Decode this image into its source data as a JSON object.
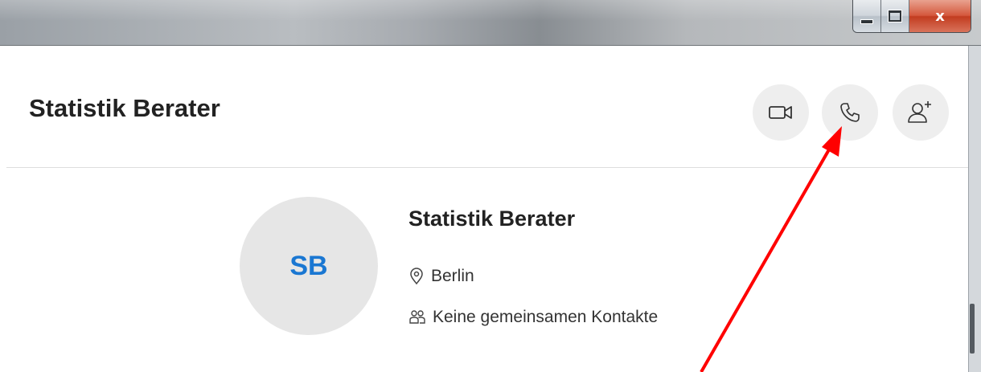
{
  "window": {
    "controls": {
      "minimize": "minimize",
      "maximize": "maximize",
      "close": "x"
    }
  },
  "header": {
    "title": "Statistik Berater",
    "actions": {
      "video_icon": "video-camera-icon",
      "call_icon": "phone-icon",
      "add_contact_icon": "add-person-icon"
    }
  },
  "profile": {
    "initials": "SB",
    "name": "Statistik Berater",
    "location": "Berlin",
    "mutual_contacts": "Keine gemeinsamen Kontakte"
  },
  "colors": {
    "initials": "#1a77d2",
    "avatar_bg": "#e6e6e6",
    "action_button_bg": "#eeeeee",
    "annotation_arrow": "#ff0000"
  }
}
